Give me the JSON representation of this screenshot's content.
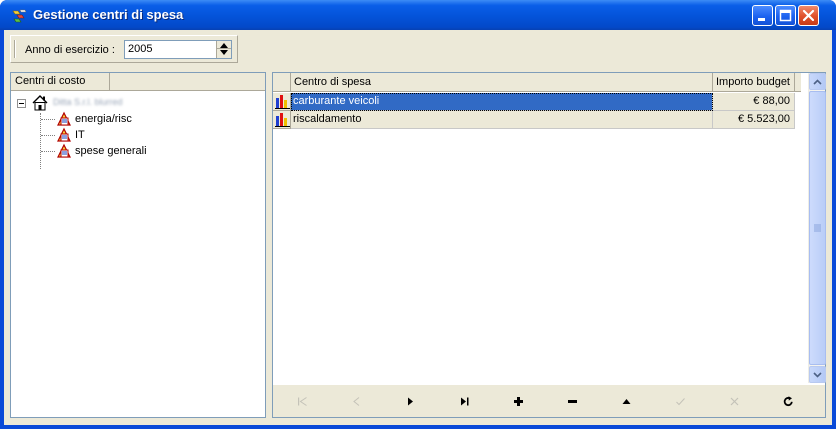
{
  "window": {
    "title": "Gestione centri di  spesa",
    "controls": [
      "minimize-icon",
      "maximize-icon",
      "close-icon"
    ]
  },
  "toolbar": {
    "year_label": "Anno di esercizio :",
    "year_value": "2005"
  },
  "tree": {
    "header": "Centri di costo",
    "root": {
      "icon": "home-icon",
      "label": "Ditta S.r.l. blurred"
    },
    "children": [
      {
        "icon": "cost-center-icon",
        "label": "energia/risc"
      },
      {
        "icon": "cost-center-icon",
        "label": "IT"
      },
      {
        "icon": "cost-center-icon",
        "label": "spese generali"
      }
    ]
  },
  "grid": {
    "columns": {
      "name": "Centro di spesa",
      "budget": "Importo budget"
    },
    "rows": [
      {
        "icon": "bar-chart-icon",
        "name": "carburante veicoli",
        "budget": "€ 88,00",
        "selected": true
      },
      {
        "icon": "bar-chart-icon",
        "name": "riscaldamento",
        "budget": "€ 5.523,00",
        "selected": false
      }
    ]
  },
  "navigator": {
    "buttons": [
      {
        "name": "first-record",
        "icon": "first-icon",
        "enabled": false
      },
      {
        "name": "prior-record",
        "icon": "prior-icon",
        "enabled": false
      },
      {
        "name": "next-record",
        "icon": "next-icon",
        "enabled": true
      },
      {
        "name": "last-record",
        "icon": "last-icon",
        "enabled": true
      },
      {
        "name": "insert-record",
        "icon": "plus-icon",
        "enabled": true
      },
      {
        "name": "delete-record",
        "icon": "minus-icon",
        "enabled": true
      },
      {
        "name": "edit-record",
        "icon": "edit-icon",
        "enabled": true
      },
      {
        "name": "post-record",
        "icon": "check-icon",
        "enabled": false
      },
      {
        "name": "cancel-record",
        "icon": "cancel-icon",
        "enabled": false
      },
      {
        "name": "refresh-records",
        "icon": "refresh-icon",
        "enabled": true
      }
    ]
  },
  "colors": {
    "titlebar": "#0453d9",
    "face": "#ece9d8",
    "selection": "#316ac5",
    "border": "#7f9db9"
  }
}
